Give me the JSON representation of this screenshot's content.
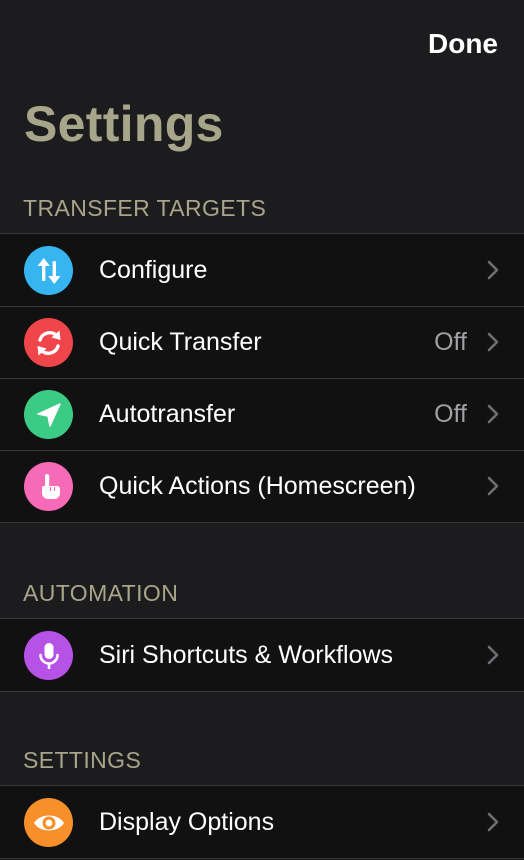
{
  "navbar": {
    "done_label": "Done"
  },
  "page": {
    "title": "Settings"
  },
  "sections": {
    "transfer_targets": {
      "header": "TRANSFER TARGETS",
      "items": [
        {
          "label": "Configure",
          "value": "",
          "icon": "arrows-up-down-icon",
          "color": "#36b5f0"
        },
        {
          "label": "Quick Transfer",
          "value": "Off",
          "icon": "refresh-icon",
          "color": "#f0464b"
        },
        {
          "label": "Autotransfer",
          "value": "Off",
          "icon": "location-arrow-icon",
          "color": "#3ccb84"
        },
        {
          "label": "Quick Actions (Homescreen)",
          "value": "",
          "icon": "hand-pointer-icon",
          "color": "#f76ab7"
        }
      ]
    },
    "automation": {
      "header": "AUTOMATION",
      "items": [
        {
          "label": "Siri Shortcuts & Workflows",
          "value": "",
          "icon": "microphone-icon",
          "color": "#b652e6"
        }
      ]
    },
    "settings": {
      "header": "SETTINGS",
      "items": [
        {
          "label": "Display Options",
          "value": "",
          "icon": "eye-icon",
          "color": "#f7902a"
        }
      ]
    }
  },
  "colors": {
    "background": "#1c1c1e",
    "cell": "#111111",
    "accent_title": "#a7a68a",
    "secondary_text": "#a0a0a5",
    "separator": "#38383a"
  }
}
